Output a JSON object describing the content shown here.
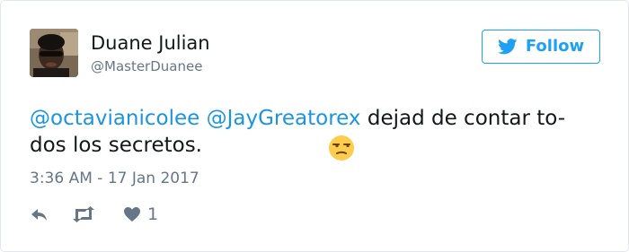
{
  "author": {
    "name": "Duane Julian",
    "handle": "@MasterDuanee"
  },
  "follow_button": {
    "label": "Follow",
    "icon": "twitter-bird-icon"
  },
  "tweet": {
    "mention_1": "@octavianicolee",
    "mention_2": "@JayGreatorex",
    "text_line1_rest": " dejad de contar to-",
    "text_line2": "dos los secretos.",
    "emoji": "unamused-face-emoji",
    "timestamp": "3:36 AM - 17 Jan 2017"
  },
  "actions": {
    "reply_icon": "reply-icon",
    "retweet_icon": "retweet-icon",
    "like_icon": "heart-icon",
    "like_count": "1"
  },
  "colors": {
    "accent": "#1da1f2",
    "mention": "#1b95e0",
    "text": "#14171a",
    "muted": "#657786",
    "border": "#e1e8ed"
  }
}
